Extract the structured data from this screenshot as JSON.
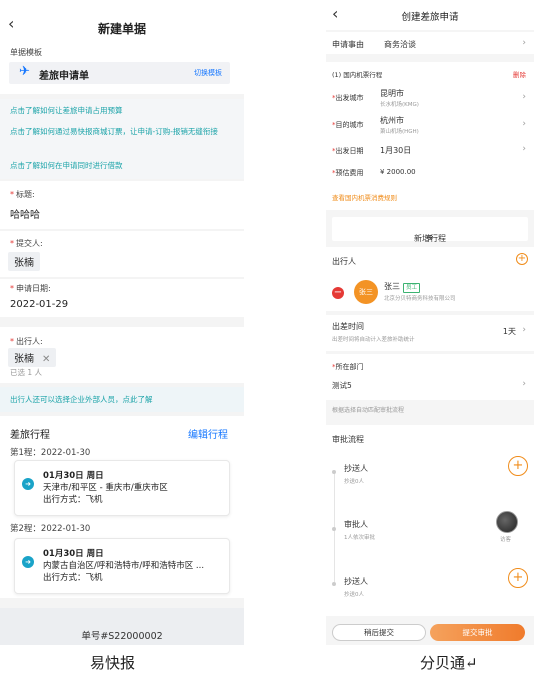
{
  "captions": {
    "left": "易快报",
    "right": "分贝通↵"
  },
  "left": {
    "title": "新建单据",
    "template_label": "单据模板",
    "template_name": "差旅申请单",
    "template_switch": "切换模板",
    "tips": [
      "点击了解如何让差旅申请占用预算",
      "点击了解如何通过易快报商城订票，让申请-订购-报销无缝衔接",
      "点击了解如何在申请同时进行借款"
    ],
    "fields": {
      "title_label": "标题:",
      "title_value": "哈哈哈",
      "submitter_label": "提交人:",
      "submitter_value": "张楠",
      "date_label": "申请日期:",
      "date_value": "2022-01-29",
      "traveler_label": "出行人:",
      "traveler_value": "张楠",
      "selected_count": "已选 1 人"
    },
    "external_note": "出行人还可以选择企业外部人员，点此了解",
    "trip": {
      "heading": "差旅行程",
      "edit_label": "编辑行程",
      "legs": [
        {
          "label": "第1程：2022-01-30",
          "date": "01月30日 周日",
          "route": "天津市/和平区 - 重庆市/重庆市区",
          "mode": "出行方式：飞机"
        },
        {
          "label": "第2程：2022-01-30",
          "date": "01月30日 周日",
          "route": "内蒙古自治区/呼和浩特市/呼和浩特市区 ...",
          "mode": "出行方式：飞机"
        }
      ]
    },
    "footer": "单号#S22000002"
  },
  "right": {
    "title": "创建差旅申请",
    "reason_label": "申请事由",
    "reason_value": "商务洽谈",
    "itinerary_label": "(1) 国内机票行程",
    "delete_label": "删除",
    "depart_label": "出发城市",
    "depart_city": "昆明市",
    "depart_airport": "长水机场(KMG)",
    "dest_label": "目的城市",
    "dest_city": "杭州市",
    "dest_airport": "萧山机场(HGH)",
    "date_label": "出发日期",
    "date_value": "1月30日",
    "budget_label": "预估费用",
    "budget_value": "¥ 2000.00",
    "rules_link": "查看国内机票消费规则",
    "add_trip": "新增行程",
    "travelers_label": "出行人",
    "traveler_avatar": "张三",
    "traveler_name": "张三",
    "traveler_tag": "员工",
    "traveler_company": "北京分贝特商务科技有限公司",
    "duration_label": "出差时间",
    "duration_hint": "出差时间将自动计入差旅补助统计",
    "duration_value": "1天",
    "dept_label": "所在部门",
    "dept_value": "测试5",
    "dept_hint": "根据选择自动匹配审批流程",
    "approval_heading": "审批流程",
    "approval": [
      {
        "title": "抄送人",
        "sub": "抄送0人"
      },
      {
        "title": "审批人",
        "sub": "1人依次审批",
        "approver": "访客"
      },
      {
        "title": "抄送人",
        "sub": "抄送0人"
      }
    ],
    "btn_later": "稍后提交",
    "btn_submit": "提交审批",
    "accent": "#f08c1a"
  }
}
